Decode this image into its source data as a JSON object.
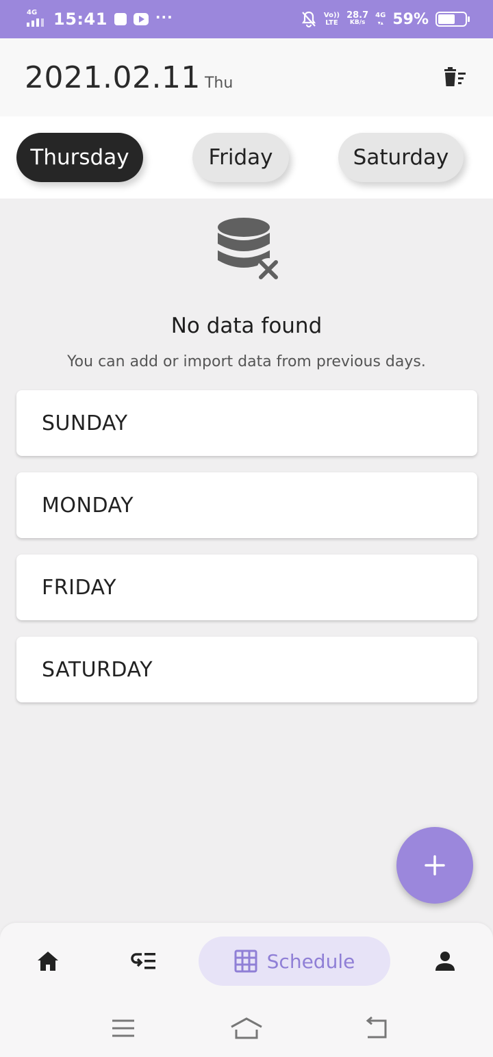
{
  "status_bar": {
    "network": "4G",
    "time": "15:41",
    "dots": "···",
    "volte": "Vo))",
    "lte": "LTE",
    "speed_value": "28.7",
    "speed_unit": "KB/s",
    "network2": "4G",
    "battery_pct": "59%"
  },
  "header": {
    "date": "2021.02.11",
    "day": "Thu"
  },
  "day_tabs": [
    {
      "label": "Thursday",
      "active": true
    },
    {
      "label": "Friday",
      "active": false
    },
    {
      "label": "Saturday",
      "active": false
    }
  ],
  "empty_state": {
    "title": "No data found",
    "subtitle": "You can add or import data from previous days."
  },
  "import_days": [
    "SUNDAY",
    "MONDAY",
    "FRIDAY",
    "SATURDAY"
  ],
  "bottom_nav": {
    "active_label": "Schedule",
    "items": [
      "home-icon",
      "list-icon",
      "grid-icon",
      "person-icon"
    ]
  },
  "colors": {
    "accent": "#9b87dc",
    "active_chip": "#262626",
    "active_nav_bg": "#e7e3f7"
  }
}
